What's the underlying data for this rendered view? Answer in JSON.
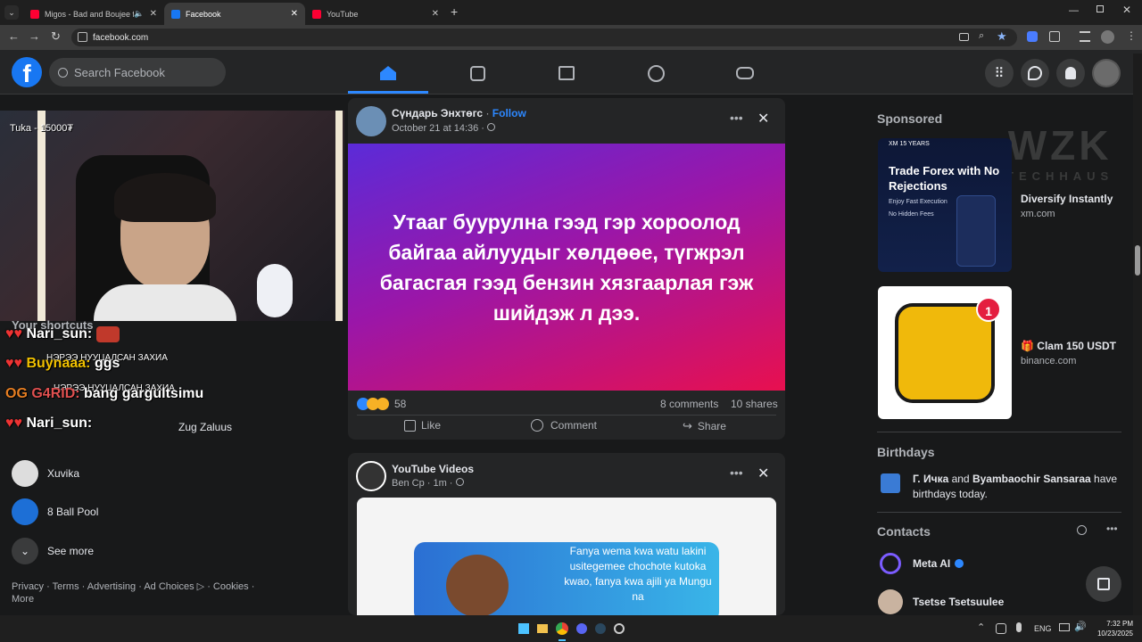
{
  "browser": {
    "tabs": [
      {
        "title": "Migos - Bad and Boujee ft. L",
        "icon": "youtube-icon",
        "color": "#ff0033"
      },
      {
        "title": "Facebook",
        "icon": "facebook-icon",
        "color": "#1877f2"
      },
      {
        "title": "YouTube",
        "icon": "youtube-icon",
        "color": "#ff0033"
      }
    ],
    "url": "facebook.com"
  },
  "header": {
    "search_placeholder": "Search Facebook",
    "nav": [
      "home-icon",
      "video-icon",
      "marketplace-icon",
      "groups-icon",
      "gaming-icon"
    ]
  },
  "stream_overlay": {
    "tip_label": "Tuka - 15000₮",
    "chat": [
      {
        "user": "Nari_sun:",
        "msg": "",
        "color": "#fff"
      },
      {
        "user": "Buynaaa:",
        "msg": "ggs",
        "color": "#f0c000"
      },
      {
        "user": "G4RID:",
        "msg": "bang gargultsimu",
        "color": "#e05050"
      },
      {
        "user": "Nari_sun:",
        "msg": "",
        "color": "#fff"
      }
    ],
    "scroll_text_1": "НЭРЭЭ НУУЦАЛСАН ЗАХИА",
    "scroll_text_2": "НЭРЭЭ НУУЦАЛСАН ЗАХИА"
  },
  "shortcuts": {
    "title": "Your shortcuts",
    "items": [
      {
        "label": "Zug Zaluus"
      },
      {
        "label": "Xuvika"
      },
      {
        "label": "8 Ball Pool"
      }
    ],
    "see_more": "See more",
    "footer": "Privacy · Terms · Advertising · Ad Choices",
    "footer2": "· Cookies ·",
    "footer3": "More"
  },
  "post1": {
    "author": "Сүндарь Энхтөгс",
    "follow": "Follow",
    "time": "October 21 at 14:36 ·",
    "text": "Утааг буурулна гээд гэр хороолод байгаа айлуудыг хөлдөөе, түгжрэл багасгая гээд бензин хязгаарлая гэж шийдэж л дээ.",
    "reactions": "58",
    "comments": "8 comments",
    "shares": "10 shares",
    "like": "Like",
    "comment": "Comment",
    "share": "Share"
  },
  "post2": {
    "author": "YouTube Videos",
    "time": "Ben Cp · 1m ·",
    "image_text": "Fanya wema kwa watu lakini usitegemee chochote kutoka kwao, fanya kwa ajili ya Mungu na"
  },
  "sponsored": {
    "title": "Sponsored",
    "ads": [
      {
        "headline": "Diversify Instantly",
        "domain": "xm.com",
        "img_title": "Trade Forex with No Rejections",
        "img_badge": "XM 15 YEARS",
        "bullet1": "Enjoy Fast Execution",
        "bullet2": "No Hidden Fees"
      },
      {
        "headline": "🎁 Clam 150 USDT",
        "domain": "binance.com",
        "badge": "1"
      }
    ]
  },
  "watermark": {
    "line1": "WZK",
    "line2": "TECHHAUS"
  },
  "birthdays": {
    "title": "Birthdays",
    "name1": "Г. Ичка",
    "and": " and ",
    "name2": "Byambaochir Sansaraa",
    "rest": " have birthdays today."
  },
  "contacts": {
    "title": "Contacts",
    "items": [
      {
        "name": "Meta AI"
      },
      {
        "name": "Tsetse Tsetsuulee"
      }
    ]
  },
  "taskbar": {
    "lang": "ENG",
    "time": "7:32 PM",
    "date": "10/23/2025"
  }
}
